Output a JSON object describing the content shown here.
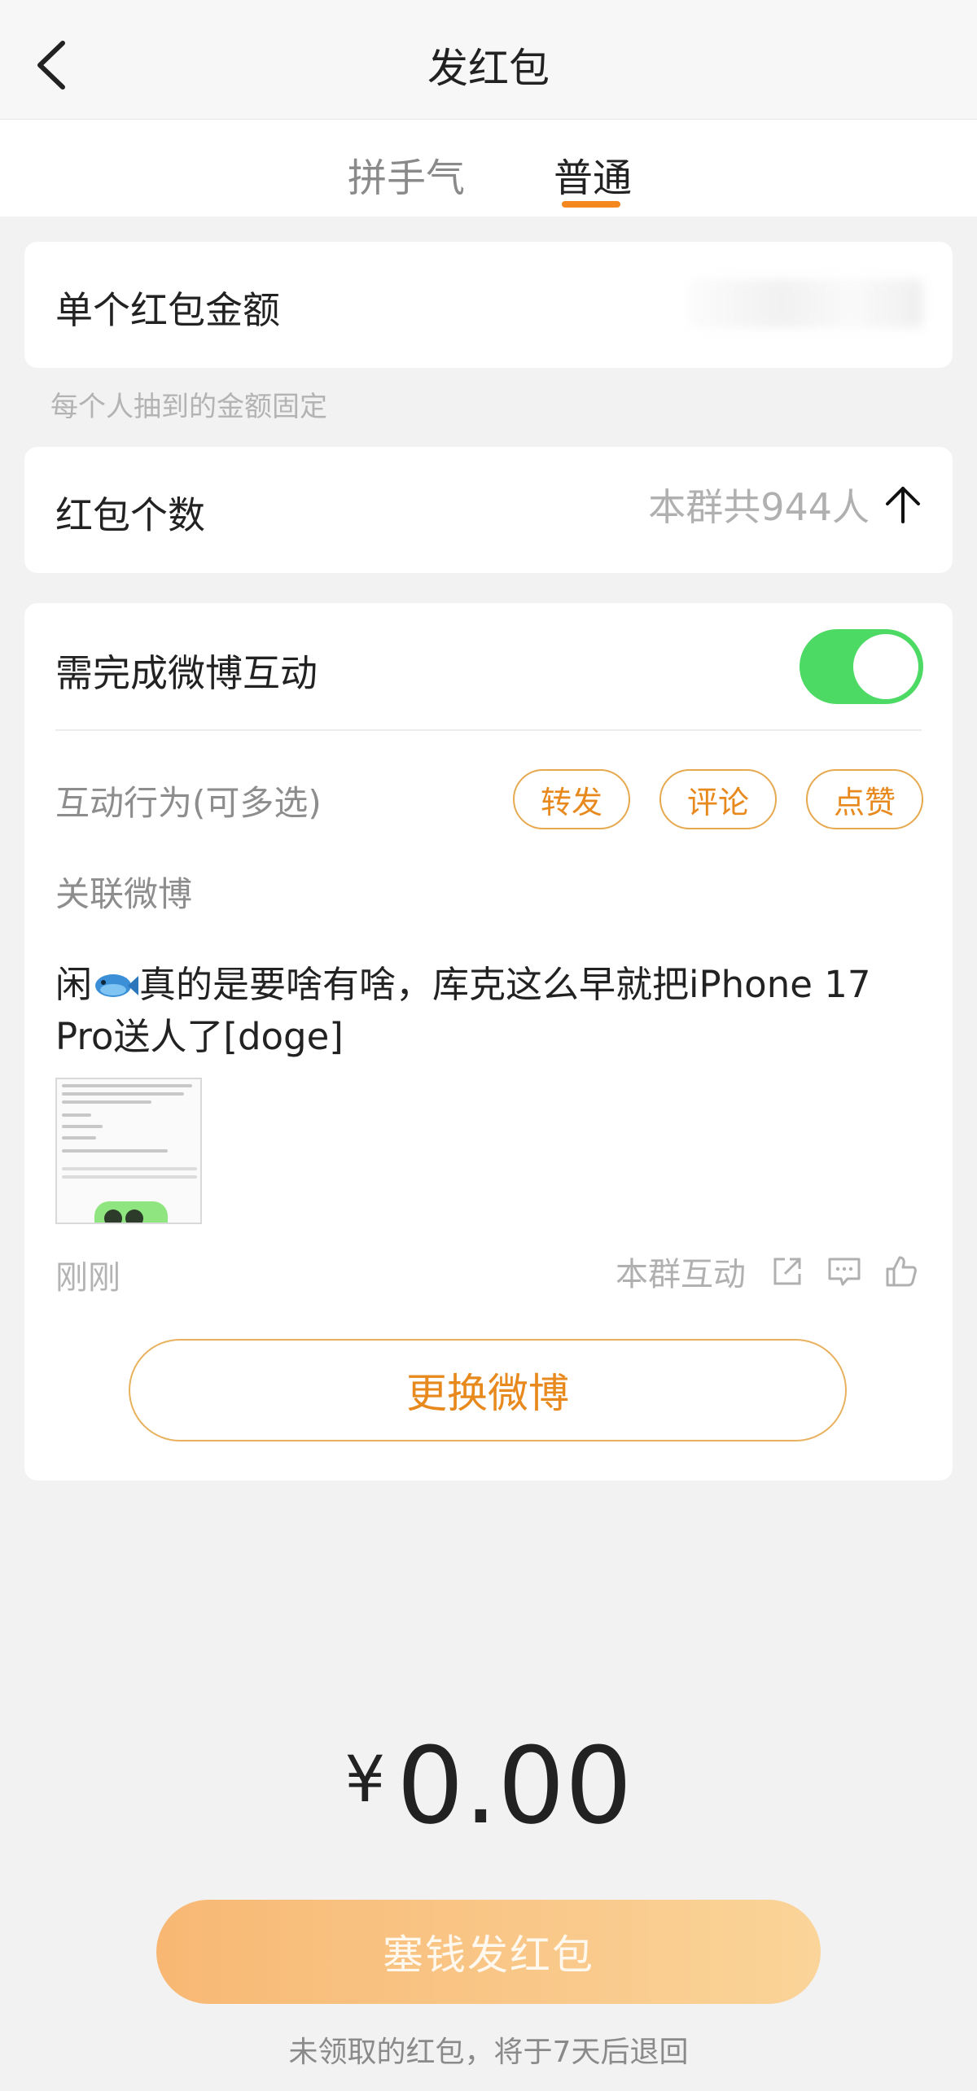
{
  "header": {
    "title": "发红包",
    "back_icon": "chevron-left-icon"
  },
  "tabs": [
    {
      "label": "拼手气",
      "active": false
    },
    {
      "label": "普通",
      "active": true
    }
  ],
  "accent_color": "#f5871f",
  "amount_row": {
    "label": "单个红包金额",
    "hint": "每个人抽到的金额固定"
  },
  "count_row": {
    "label": "红包个数",
    "group_info": "本群共944人",
    "cursor_icon": "text-cursor-icon"
  },
  "interaction": {
    "label": "需完成微博互动",
    "toggle_on": true,
    "toggle_color": "#4cd964",
    "actions_label": "互动行为(可多选)",
    "actions": [
      "转发",
      "评论",
      "点赞"
    ],
    "linked_label": "关联微博",
    "post": {
      "text_before": "闲",
      "text_after": "真的是要啥有啥，库克这么早就把iPhone 17 Pro送人了[doge]",
      "time": "刚刚",
      "group_action": "本群互动"
    },
    "change_button": "更换微博"
  },
  "total": {
    "currency": "¥",
    "value": "0.00"
  },
  "submit": {
    "label": "塞钱发红包"
  },
  "footnote": "未领取的红包，将于7天后退回"
}
